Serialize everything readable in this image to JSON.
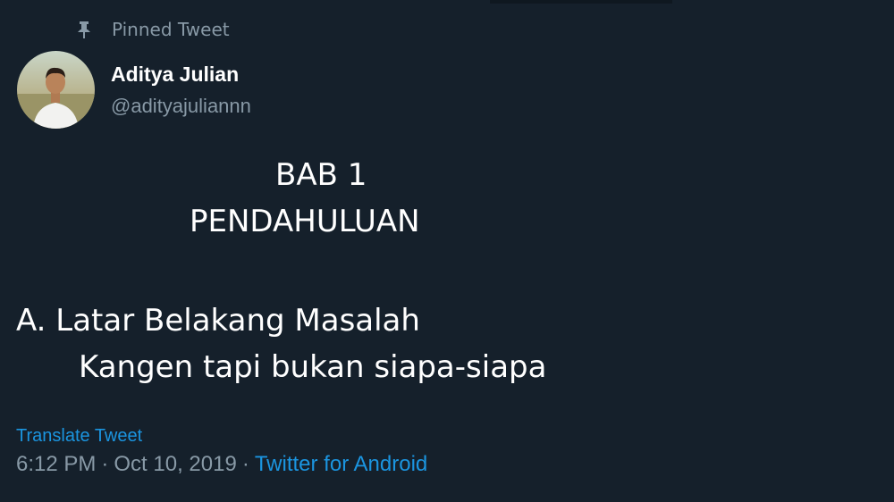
{
  "pinned": {
    "icon": "pin-icon",
    "label": "Pinned Tweet"
  },
  "author": {
    "display_name": "Aditya Julian",
    "handle": "@adityajuliannn",
    "avatar": "avatar-photo"
  },
  "tweet": {
    "lines": [
      "BAB 1",
      "PENDAHULUAN",
      "A. Latar Belakang Masalah",
      "Kangen tapi bukan siapa-siapa"
    ]
  },
  "translate_label": "Translate Tweet",
  "meta": {
    "time": "6:12 PM",
    "separator": "·",
    "date": "Oct 10, 2019",
    "source": "Twitter for Android"
  },
  "colors": {
    "background": "#15202b",
    "primary_text": "#ffffff",
    "secondary_text": "#8899a6",
    "link": "#1b95e0"
  }
}
